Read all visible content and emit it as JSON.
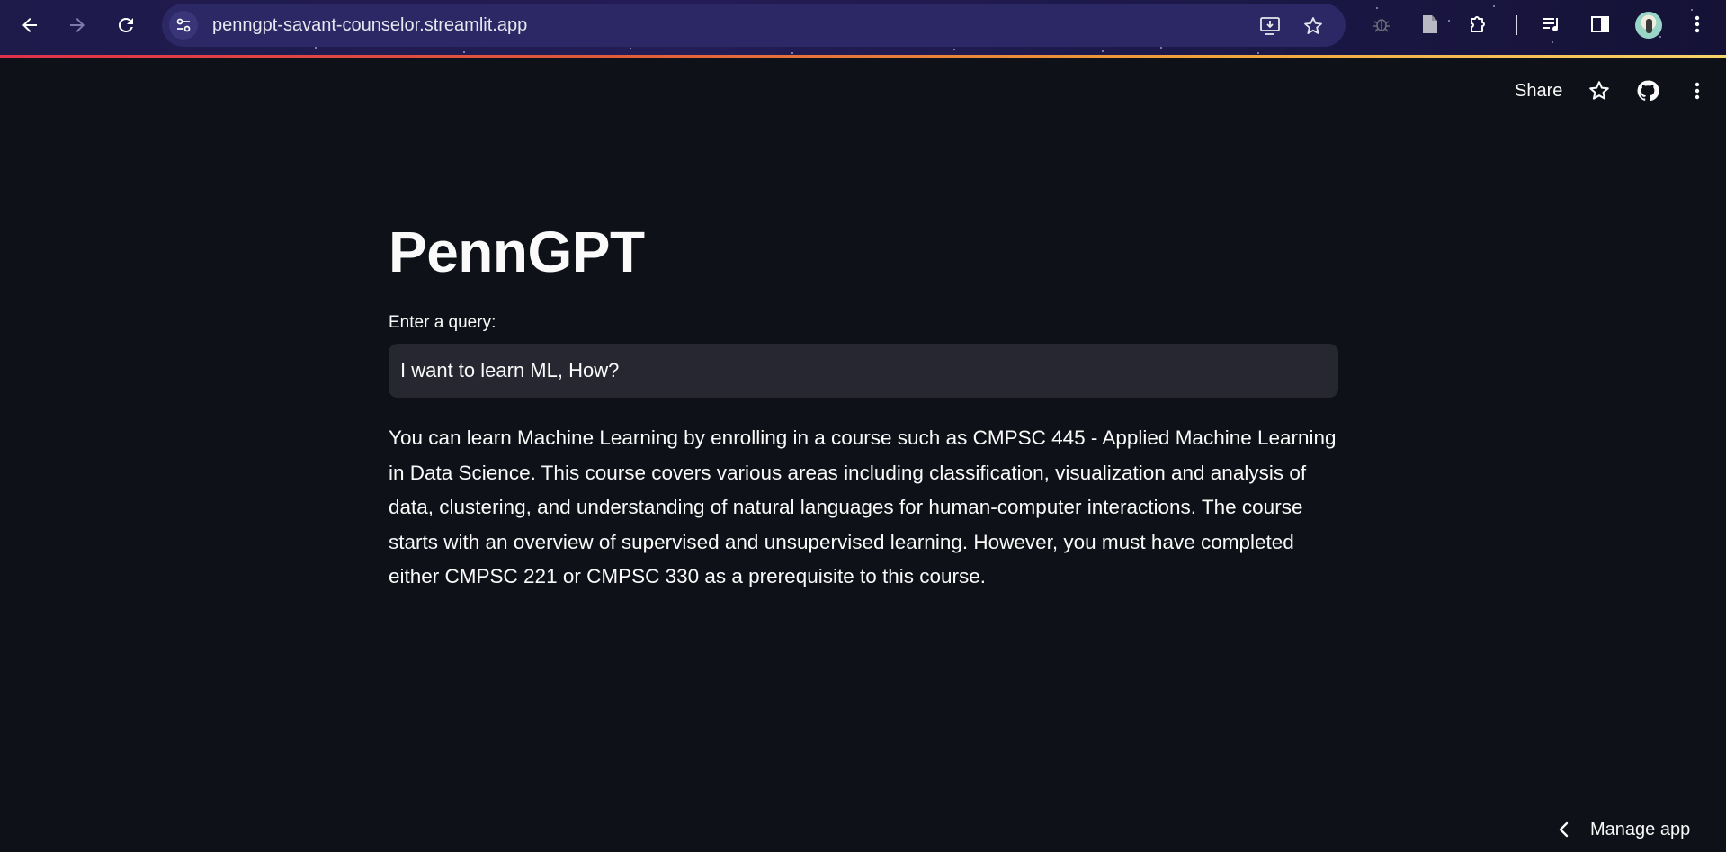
{
  "browser": {
    "url": "penngpt-savant-counselor.streamlit.app"
  },
  "header": {
    "share_label": "Share"
  },
  "main": {
    "title": "PennGPT",
    "query_label": "Enter a query:",
    "query_value": "I want to learn ML, How?",
    "answer": "You can learn Machine Learning by enrolling in a course such as CMPSC 445 - Applied Machine Learning in Data Science. This course covers various areas including classification, visualization and analysis of data, clustering, and understanding of natural languages for human-computer interactions. The course starts with an overview of supervised and unsupervised learning. However, you must have completed either CMPSC 221 or CMPSC 330 as a prerequisite to this course."
  },
  "footer": {
    "manage_app_label": "Manage app"
  },
  "colors": {
    "background": "#0e1117",
    "input_background": "#262730",
    "text": "#fafafa",
    "accent_gradient_start": "#e0324b",
    "accent_gradient_end": "#f7d46a"
  },
  "icons": {
    "back": "arrow-left-icon",
    "forward": "arrow-right-icon",
    "reload": "reload-icon",
    "site_info": "tune-icon",
    "install": "install-app-icon",
    "bookmark": "star-icon",
    "extensions": [
      "bug-extension-icon",
      "document-extension-icon",
      "puzzle-icon",
      "media-controls-icon",
      "side-panel-icon"
    ],
    "profile": "avatar",
    "menu": "kebab-menu-icon",
    "github": "github-icon",
    "manage_chevron": "chevron-left-icon"
  }
}
